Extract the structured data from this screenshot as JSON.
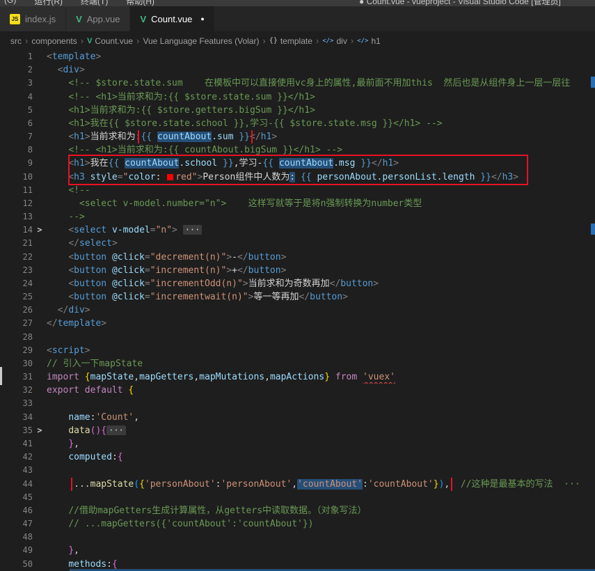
{
  "title_bar": {
    "menus": [
      "(G)",
      "运行(R)",
      "终端(T)",
      "帮助(H)"
    ],
    "window_title": "● Count.vue - vueproject - Visual Studio Code [管理员]"
  },
  "tabs": [
    {
      "icon": "js-icon",
      "label": "index.js",
      "active": false,
      "modified": false
    },
    {
      "icon": "vue-icon",
      "label": "App.vue",
      "active": false,
      "modified": false
    },
    {
      "icon": "vue-icon",
      "label": "Count.vue",
      "active": true,
      "modified": true
    }
  ],
  "breadcrumb": {
    "separator": "›",
    "items": [
      {
        "label": "src"
      },
      {
        "label": "components"
      },
      {
        "label": "Count.vue",
        "icon": "vue-icon"
      },
      {
        "label": "Vue Language Features (Volar)"
      },
      {
        "label": "template",
        "icon": "braces-icon"
      },
      {
        "label": "div",
        "icon": "element-icon"
      },
      {
        "label": "h1",
        "icon": "element-icon"
      }
    ]
  },
  "colors": {
    "annotation_red": "#e81123",
    "selection_blue": "#264f78",
    "vue_green": "#41b883",
    "js_yellow": "#f5de19",
    "comment_green": "#6a9955",
    "tag_blue": "#569cd6",
    "string_orange": "#ce9178"
  },
  "editor": {
    "folded_lines": [
      14,
      35
    ],
    "lines": [
      {
        "num": 1,
        "tokens": [
          [
            "<",
            "p"
          ],
          [
            "template",
            "t"
          ],
          [
            ">",
            "p"
          ]
        ]
      },
      {
        "num": 2,
        "tokens": [
          [
            "  ",
            "w"
          ],
          [
            "<",
            "p"
          ],
          [
            "div",
            "t"
          ],
          [
            ">",
            "p"
          ]
        ]
      },
      {
        "num": 3,
        "tokens": [
          [
            "    ",
            "w"
          ],
          [
            "<!-- $store.state.sum    在模板中可以直接使用vc身上的属性,最前面不用加this  然后也是从组件身上一层一层往",
            "c"
          ]
        ]
      },
      {
        "num": 4,
        "tokens": [
          [
            "    ",
            "w"
          ],
          [
            "<!-- <h1>当前求和为:{{ $store.state.sum }}</h1>",
            "c"
          ]
        ]
      },
      {
        "num": 5,
        "tokens": [
          [
            "    ",
            "w"
          ],
          [
            "<h1>当前求和为:{{ $store.getters.bigSum }}</h1>",
            "c"
          ]
        ]
      },
      {
        "num": 6,
        "tokens": [
          [
            "    ",
            "w"
          ],
          [
            "<h1>我在{{ $store.state.school }},学习-{{ $store.state.msg }}</h1> -->",
            "c"
          ]
        ]
      },
      {
        "num": 7,
        "tokens": [
          [
            "    ",
            "w"
          ],
          [
            "<",
            "p"
          ],
          [
            "h1",
            "t"
          ],
          [
            ">",
            "p"
          ],
          [
            "当前求和为:",
            "w"
          ],
          [
            "{{ ",
            "i",
            "box"
          ],
          [
            "countAbout",
            "v",
            "box sel"
          ],
          [
            ".sum",
            "v",
            "box"
          ],
          [
            " }}",
            "i",
            "box"
          ],
          [
            "</",
            "p"
          ],
          [
            "h1",
            "t"
          ],
          [
            ">",
            "p"
          ]
        ]
      },
      {
        "num": 8,
        "tokens": [
          [
            "    ",
            "w"
          ],
          [
            "<!-- <h1>当前求和为:{{ countAbout.bigSum }}</h1> -->",
            "c"
          ]
        ]
      },
      {
        "num": 9,
        "tokens": [
          [
            "    ",
            "w"
          ],
          [
            "<",
            "p"
          ],
          [
            "h1",
            "t"
          ],
          [
            ">",
            "p"
          ],
          [
            "我在",
            "w"
          ],
          [
            "{{ ",
            "i"
          ],
          [
            "countAbout",
            "v",
            "sel"
          ],
          [
            ".school",
            "v"
          ],
          [
            " }}",
            "i"
          ],
          [
            ",学习-",
            "w"
          ],
          [
            "{{ ",
            "i"
          ],
          [
            "countAbout",
            "v",
            "sel"
          ],
          [
            ".msg",
            "v"
          ],
          [
            " }}",
            "i"
          ],
          [
            "</",
            "p"
          ],
          [
            "h1",
            "t"
          ],
          [
            ">",
            "p"
          ]
        ]
      },
      {
        "num": 10,
        "tokens": [
          [
            "    ",
            "w"
          ],
          [
            "<",
            "p"
          ],
          [
            "h3",
            "t"
          ],
          [
            " ",
            "w"
          ],
          [
            "style",
            "a"
          ],
          [
            "=",
            "p"
          ],
          [
            "\"",
            "s"
          ],
          [
            "color",
            "a"
          ],
          [
            ": ",
            "w"
          ],
          [
            "",
            "swatch"
          ],
          [
            "red",
            "s"
          ],
          [
            "\"",
            "s"
          ],
          [
            ">",
            "p"
          ],
          [
            "Person组件中人数为",
            "w"
          ],
          [
            ":",
            "w",
            "sel"
          ],
          [
            " ",
            "w"
          ],
          [
            "{{ ",
            "i"
          ],
          [
            "personAbout.personList.length",
            "v"
          ],
          [
            " }}",
            "i"
          ],
          [
            "</",
            "p"
          ],
          [
            "h3",
            "t"
          ],
          [
            ">",
            "p"
          ]
        ]
      },
      {
        "num": 11,
        "tokens": [
          [
            "    ",
            "w"
          ],
          [
            "<!--",
            "c"
          ]
        ]
      },
      {
        "num": 12,
        "tokens": [
          [
            "      ",
            "w"
          ],
          [
            "<select v-model.number=\"n\">    这样写就等于是将n强制转换为number类型",
            "c"
          ]
        ]
      },
      {
        "num": 13,
        "tokens": [
          [
            "    ",
            "w"
          ],
          [
            "-->",
            "c"
          ]
        ]
      },
      {
        "num": 14,
        "fold": true,
        "tokens": [
          [
            "    ",
            "w"
          ],
          [
            "<",
            "p"
          ],
          [
            "select",
            "t"
          ],
          [
            " ",
            "w"
          ],
          [
            "v-model",
            "a"
          ],
          [
            "=",
            "p"
          ],
          [
            "\"n\"",
            "s"
          ],
          [
            ">",
            "p"
          ],
          [
            " ",
            "w"
          ],
          [
            "···",
            "fe"
          ]
        ]
      },
      {
        "num": 21,
        "tokens": [
          [
            "    ",
            "w"
          ],
          [
            "</",
            "p"
          ],
          [
            "select",
            "t"
          ],
          [
            ">",
            "p"
          ]
        ]
      },
      {
        "num": 22,
        "tokens": [
          [
            "    ",
            "w"
          ],
          [
            "<",
            "p"
          ],
          [
            "button",
            "t"
          ],
          [
            " ",
            "w"
          ],
          [
            "@click",
            "a"
          ],
          [
            "=",
            "p"
          ],
          [
            "\"decrement(n)\"",
            "s"
          ],
          [
            ">",
            "p"
          ],
          [
            "-",
            "w"
          ],
          [
            "</",
            "p"
          ],
          [
            "button",
            "t"
          ],
          [
            ">",
            "p"
          ]
        ]
      },
      {
        "num": 23,
        "tokens": [
          [
            "    ",
            "w"
          ],
          [
            "<",
            "p"
          ],
          [
            "button",
            "t"
          ],
          [
            " ",
            "w"
          ],
          [
            "@click",
            "a"
          ],
          [
            "=",
            "p"
          ],
          [
            "\"increment(n)\"",
            "s"
          ],
          [
            ">",
            "p"
          ],
          [
            "+",
            "w"
          ],
          [
            "</",
            "p"
          ],
          [
            "button",
            "t"
          ],
          [
            ">",
            "p"
          ]
        ]
      },
      {
        "num": 24,
        "tokens": [
          [
            "    ",
            "w"
          ],
          [
            "<",
            "p"
          ],
          [
            "button",
            "t"
          ],
          [
            " ",
            "w"
          ],
          [
            "@click",
            "a"
          ],
          [
            "=",
            "p"
          ],
          [
            "\"incrementOdd(n)\"",
            "s"
          ],
          [
            ">",
            "p"
          ],
          [
            "当前求和为奇数再加",
            "w"
          ],
          [
            "</",
            "p"
          ],
          [
            "button",
            "t"
          ],
          [
            ">",
            "p"
          ]
        ]
      },
      {
        "num": 25,
        "tokens": [
          [
            "    ",
            "w"
          ],
          [
            "<",
            "p"
          ],
          [
            "button",
            "t"
          ],
          [
            " ",
            "w"
          ],
          [
            "@click",
            "a"
          ],
          [
            "=",
            "p"
          ],
          [
            "\"incrementwait(n)\"",
            "s"
          ],
          [
            ">",
            "p"
          ],
          [
            "等一等再加",
            "w"
          ],
          [
            "</",
            "p"
          ],
          [
            "button",
            "t"
          ],
          [
            ">",
            "p"
          ]
        ]
      },
      {
        "num": 26,
        "tokens": [
          [
            "  ",
            "w"
          ],
          [
            "</",
            "p"
          ],
          [
            "div",
            "t"
          ],
          [
            ">",
            "p"
          ]
        ]
      },
      {
        "num": 27,
        "tokens": [
          [
            "</",
            "p"
          ],
          [
            "template",
            "t"
          ],
          [
            ">",
            "p"
          ]
        ]
      },
      {
        "num": 28,
        "tokens": []
      },
      {
        "num": 29,
        "tokens": [
          [
            "<",
            "p"
          ],
          [
            "script",
            "t"
          ],
          [
            ">",
            "p"
          ]
        ]
      },
      {
        "num": 30,
        "tokens": [
          [
            "// 引入一下mapState",
            "c"
          ]
        ]
      },
      {
        "num": 31,
        "tokens": [
          [
            "import",
            "k"
          ],
          [
            " ",
            "w"
          ],
          [
            "{",
            "b1"
          ],
          [
            "mapState",
            "v"
          ],
          [
            ",",
            "w"
          ],
          [
            "mapGetters",
            "v"
          ],
          [
            ",",
            "w"
          ],
          [
            "mapMutations",
            "v"
          ],
          [
            ",",
            "w"
          ],
          [
            "mapActions",
            "v"
          ],
          [
            "}",
            "b1"
          ],
          [
            " ",
            "w"
          ],
          [
            "from",
            "k"
          ],
          [
            " ",
            "w"
          ],
          [
            "'vuex'",
            "s",
            "sq"
          ]
        ]
      },
      {
        "num": 32,
        "tokens": [
          [
            "export",
            "k"
          ],
          [
            " ",
            "w"
          ],
          [
            "default",
            "k"
          ],
          [
            " ",
            "w"
          ],
          [
            "{",
            "b1"
          ]
        ]
      },
      {
        "num": 33,
        "tokens": []
      },
      {
        "num": 34,
        "tokens": [
          [
            "    ",
            "w"
          ],
          [
            "name",
            "a"
          ],
          [
            ":",
            "w"
          ],
          [
            "'Count'",
            "s"
          ],
          [
            ",",
            "w"
          ]
        ]
      },
      {
        "num": 35,
        "fold": true,
        "tokens": [
          [
            "    ",
            "w"
          ],
          [
            "data",
            "f"
          ],
          [
            "(",
            "b2"
          ],
          [
            ")",
            "b2"
          ],
          [
            "{",
            "b2"
          ],
          [
            "···",
            "fe"
          ]
        ]
      },
      {
        "num": 41,
        "tokens": [
          [
            "    ",
            "w"
          ],
          [
            "}",
            "b2"
          ],
          [
            ",",
            "w"
          ]
        ]
      },
      {
        "num": 42,
        "tokens": [
          [
            "    ",
            "w"
          ],
          [
            "computed",
            "a"
          ],
          [
            ":",
            "w"
          ],
          [
            "{",
            "b2"
          ]
        ]
      },
      {
        "num": 43,
        "tokens": []
      },
      {
        "num": 44,
        "tokens": [
          [
            "     ",
            "w"
          ],
          [
            "...",
            "w",
            "box"
          ],
          [
            "mapState",
            "f",
            "box"
          ],
          [
            "(",
            "b3",
            "box"
          ],
          [
            "{",
            "b1",
            "box"
          ],
          [
            "'personAbout'",
            "s",
            "box"
          ],
          [
            ":",
            "w",
            "box"
          ],
          [
            "'personAbout'",
            "s",
            "box"
          ],
          [
            ",",
            "w",
            "box"
          ],
          [
            "'countAbout'",
            "s",
            "box sel"
          ],
          [
            ":",
            "w",
            "box"
          ],
          [
            "'countAbout'",
            "s",
            "box"
          ],
          [
            "}",
            "b1",
            "box"
          ],
          [
            ")",
            "b3",
            "box"
          ],
          [
            ",",
            "w",
            "box"
          ],
          [
            "  ",
            "w"
          ],
          [
            "//这种是最基本的写法  ···",
            "c"
          ]
        ]
      },
      {
        "num": 45,
        "tokens": []
      },
      {
        "num": 46,
        "tokens": [
          [
            "    ",
            "w"
          ],
          [
            "//借助mapGetters生成计算属性，从getters中读取数据。（对象写法）",
            "c"
          ]
        ]
      },
      {
        "num": 47,
        "tokens": [
          [
            "    ",
            "w"
          ],
          [
            "// ...mapGetters({'countAbout':'countAbout'})",
            "c"
          ]
        ]
      },
      {
        "num": 48,
        "tokens": []
      },
      {
        "num": 49,
        "tokens": [
          [
            "    ",
            "w"
          ],
          [
            "}",
            "b2"
          ],
          [
            ",",
            "w"
          ]
        ]
      },
      {
        "num": 50,
        "tokens": [
          [
            "    ",
            "w"
          ],
          [
            "methods",
            "a"
          ],
          [
            ":",
            "w"
          ],
          [
            "{",
            "b2"
          ]
        ]
      }
    ]
  }
}
